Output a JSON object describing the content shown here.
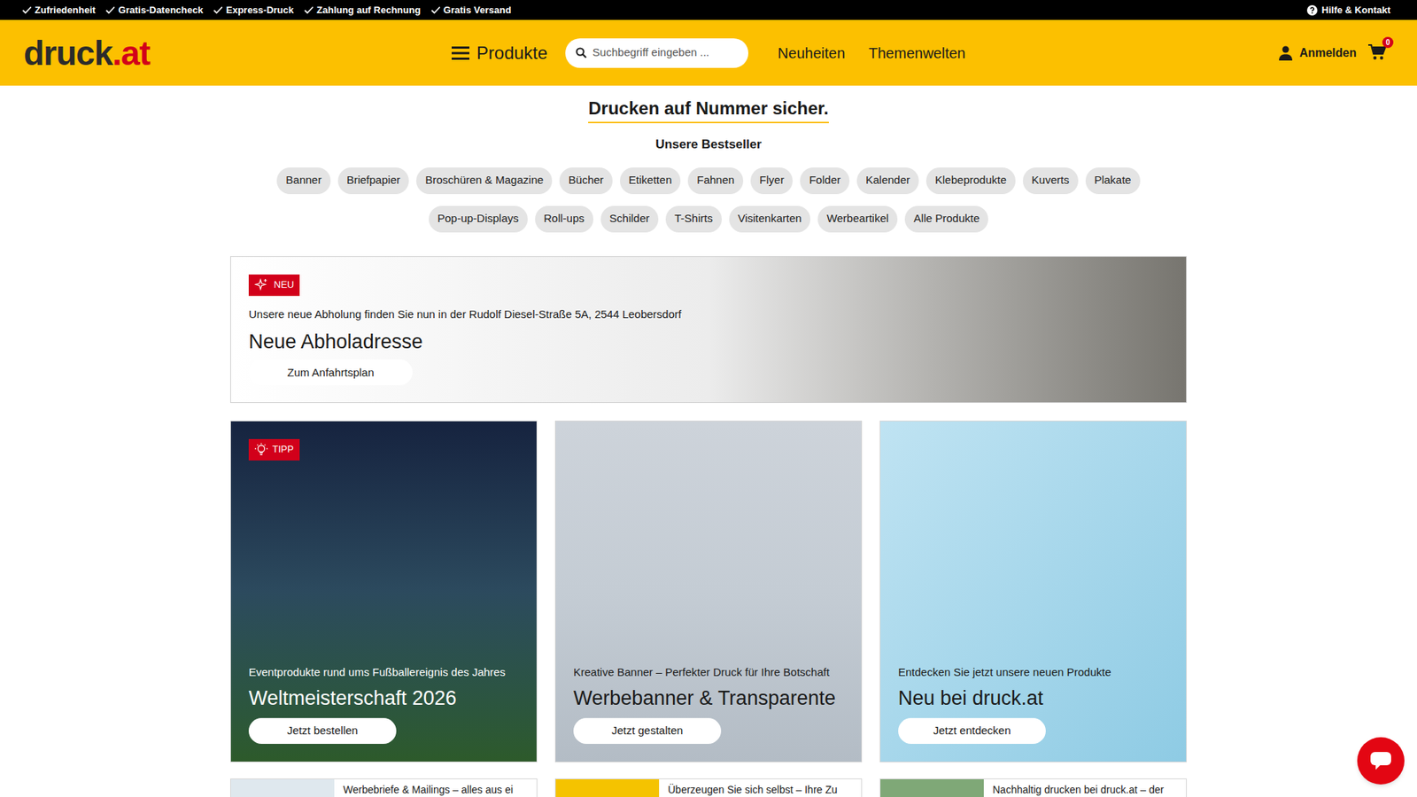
{
  "topbar": {
    "usps": [
      "Zufriedenheit",
      "Gratis-Datencheck",
      "Express-Druck",
      "Zahlung auf Rechnung",
      "Gratis Versand"
    ],
    "help": "Hilfe & Kontakt"
  },
  "header": {
    "logo": {
      "main": "druck",
      "tld": ".at"
    },
    "menu": "Produkte",
    "search": {
      "placeholder": "Suchbegriff eingeben ..."
    },
    "nav": [
      "Neuheiten",
      "Themenwelten"
    ],
    "login": "Anmelden",
    "cart_count": "0"
  },
  "hero": {
    "title": "Drucken auf Nummer sicher.",
    "subtitle": "Unsere Bestseller"
  },
  "categories": [
    [
      "Banner",
      "Briefpapier",
      "Broschüren & Magazine",
      "Bücher",
      "Etiketten",
      "Fahnen",
      "Flyer",
      "Folder",
      "Kalender",
      "Klebeprodukte",
      "Kuverts",
      "Plakate"
    ],
    [
      "Pop-up-Displays",
      "Roll-ups",
      "Schilder",
      "T-Shirts",
      "Visitenkarten",
      "Werbeartikel",
      "Alle Produkte"
    ]
  ],
  "notice": {
    "badge": "NEU",
    "text": "Unsere neue Abholung finden Sie nun in der Rudolf Diesel-Straße 5A, 2544 Leobersdorf",
    "title": "Neue Abholadresse",
    "button": "Zum Anfahrtsplan"
  },
  "cards": [
    {
      "kind": "dark",
      "badge": "TIPP",
      "subtitle": "Eventprodukte rund ums Fußballereignis des Jahres",
      "title": "Weltmeisterschaft 2026",
      "button": "Jetzt bestellen"
    },
    {
      "kind": "light",
      "subtitle": "Kreative Banner – Perfekter Druck für Ihre Botschaft",
      "title": "Werbebanner & Transparente",
      "button": "Jetzt gestalten"
    },
    {
      "kind": "sky",
      "subtitle": "Entdecken Sie jetzt unsere neuen Produkte",
      "title": "Neu bei druck.at",
      "button": "Jetzt entdecken"
    }
  ],
  "teasers": [
    "Werbebriefe & Mailings – alles aus ei",
    "Überzeugen Sie sich selbst – Ihre Zu",
    "Nachhaltig drucken bei druck.at – der"
  ]
}
